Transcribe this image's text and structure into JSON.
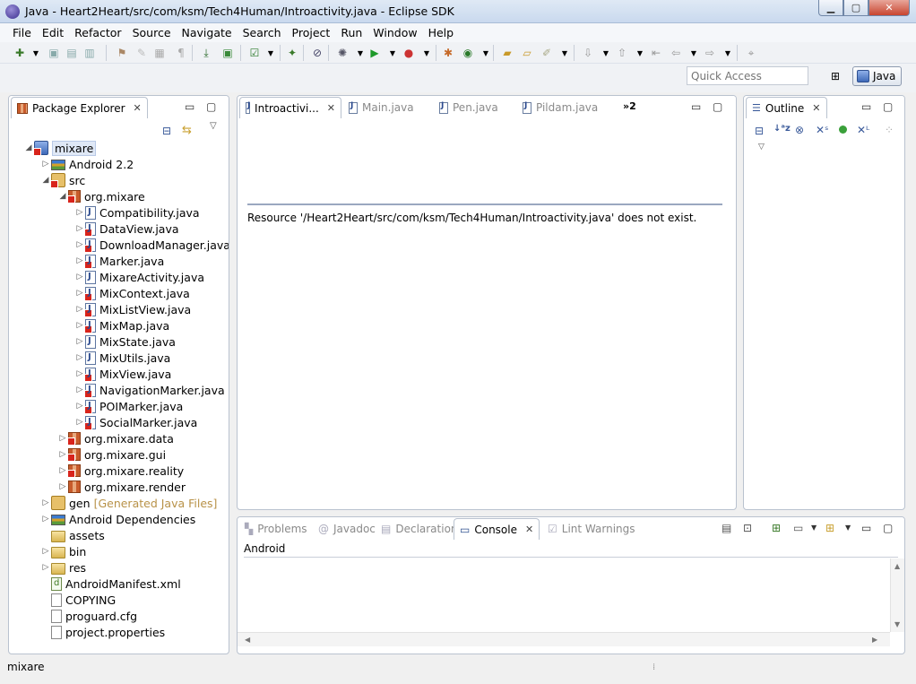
{
  "window": {
    "title": "Java - Heart2Heart/src/com/ksm/Tech4Human/Introactivity.java - Eclipse SDK"
  },
  "menu": [
    "File",
    "Edit",
    "Refactor",
    "Source",
    "Navigate",
    "Search",
    "Project",
    "Run",
    "Window",
    "Help"
  ],
  "quick_access": {
    "placeholder": "Quick Access"
  },
  "perspective": {
    "label": "Java"
  },
  "package_explorer": {
    "tab_label": "Package Explorer",
    "tree": [
      {
        "label": "mixare",
        "indent": 0,
        "twisty": "open",
        "icon": "proj",
        "error": true
      },
      {
        "label": "Android 2.2",
        "indent": 1,
        "twisty": "closed",
        "icon": "lib",
        "error": false
      },
      {
        "label": "src",
        "indent": 1,
        "twisty": "open",
        "icon": "src",
        "error": true
      },
      {
        "label": "org.mixare",
        "indent": 2,
        "twisty": "open",
        "icon": "pkg",
        "error": true
      },
      {
        "label": "Compatibility.java",
        "indent": 3,
        "twisty": "closed",
        "icon": "java",
        "error": false
      },
      {
        "label": "DataView.java",
        "indent": 3,
        "twisty": "closed",
        "icon": "java",
        "error": true
      },
      {
        "label": "DownloadManager.java",
        "indent": 3,
        "twisty": "closed",
        "icon": "java",
        "error": true
      },
      {
        "label": "Marker.java",
        "indent": 3,
        "twisty": "closed",
        "icon": "java",
        "error": true
      },
      {
        "label": "MixareActivity.java",
        "indent": 3,
        "twisty": "closed",
        "icon": "java",
        "error": false
      },
      {
        "label": "MixContext.java",
        "indent": 3,
        "twisty": "closed",
        "icon": "java",
        "error": true
      },
      {
        "label": "MixListView.java",
        "indent": 3,
        "twisty": "closed",
        "icon": "java",
        "error": true
      },
      {
        "label": "MixMap.java",
        "indent": 3,
        "twisty": "closed",
        "icon": "java",
        "error": true
      },
      {
        "label": "MixState.java",
        "indent": 3,
        "twisty": "closed",
        "icon": "java",
        "error": false
      },
      {
        "label": "MixUtils.java",
        "indent": 3,
        "twisty": "closed",
        "icon": "java",
        "error": false
      },
      {
        "label": "MixView.java",
        "indent": 3,
        "twisty": "closed",
        "icon": "java",
        "error": true
      },
      {
        "label": "NavigationMarker.java",
        "indent": 3,
        "twisty": "closed",
        "icon": "java",
        "error": true
      },
      {
        "label": "POIMarker.java",
        "indent": 3,
        "twisty": "closed",
        "icon": "java",
        "error": true
      },
      {
        "label": "SocialMarker.java",
        "indent": 3,
        "twisty": "closed",
        "icon": "java",
        "error": true
      },
      {
        "label": "org.mixare.data",
        "indent": 2,
        "twisty": "closed",
        "icon": "pkg",
        "error": true
      },
      {
        "label": "org.mixare.gui",
        "indent": 2,
        "twisty": "closed",
        "icon": "pkg",
        "error": true
      },
      {
        "label": "org.mixare.reality",
        "indent": 2,
        "twisty": "closed",
        "icon": "pkg",
        "error": true
      },
      {
        "label": "org.mixare.render",
        "indent": 2,
        "twisty": "closed",
        "icon": "pkg",
        "error": false
      },
      {
        "label": "gen",
        "indent": 1,
        "twisty": "closed",
        "icon": "src",
        "error": false,
        "decoration": "[Generated Java Files]"
      },
      {
        "label": "Android Dependencies",
        "indent": 1,
        "twisty": "closed",
        "icon": "lib",
        "error": false
      },
      {
        "label": "assets",
        "indent": 1,
        "twisty": "none",
        "icon": "folder",
        "error": false
      },
      {
        "label": "bin",
        "indent": 1,
        "twisty": "closed",
        "icon": "folder",
        "error": false
      },
      {
        "label": "res",
        "indent": 1,
        "twisty": "closed",
        "icon": "folder",
        "error": false
      },
      {
        "label": "AndroidManifest.xml",
        "indent": 1,
        "twisty": "none",
        "icon": "xmlf",
        "error": false
      },
      {
        "label": "COPYING",
        "indent": 1,
        "twisty": "none",
        "icon": "txt",
        "error": false
      },
      {
        "label": "proguard.cfg",
        "indent": 1,
        "twisty": "none",
        "icon": "txt",
        "error": false
      },
      {
        "label": "project.properties",
        "indent": 1,
        "twisty": "none",
        "icon": "txt",
        "error": false
      }
    ]
  },
  "editor": {
    "tabs": [
      {
        "label": "Introactivi...",
        "active": true
      },
      {
        "label": "Main.java",
        "active": false
      },
      {
        "label": "Pen.java",
        "active": false
      },
      {
        "label": "Pildam.java",
        "active": false
      }
    ],
    "overflow": "»2",
    "message": "Resource '/Heart2Heart/src/com/ksm/Tech4Human/Introactivity.java' does not exist."
  },
  "outline": {
    "tab_label": "Outline"
  },
  "bottom_panel": {
    "tabs": [
      {
        "label": "Problems",
        "active": false,
        "icon": "problems-icon"
      },
      {
        "label": "Javadoc",
        "active": false,
        "icon": "javadoc-icon"
      },
      {
        "label": "Declaration",
        "active": false,
        "icon": "declaration-icon"
      },
      {
        "label": "Console",
        "active": true,
        "icon": "console-icon"
      },
      {
        "label": "Lint Warnings",
        "active": false,
        "icon": "lint-icon"
      }
    ],
    "console_title": "Android"
  },
  "status": {
    "text": "mixare"
  },
  "colors": {
    "error": "#d8241c",
    "decoration": "#b89248",
    "inactive_tab": "#8a8a8a"
  }
}
